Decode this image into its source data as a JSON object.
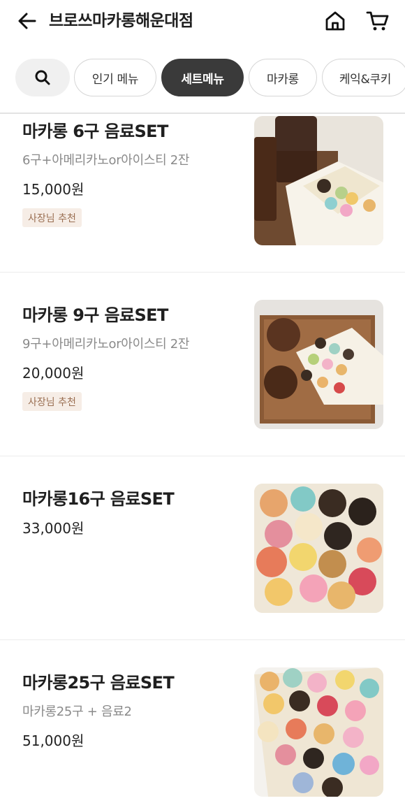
{
  "header": {
    "back_icon": "arrow-left-icon",
    "title": "브로쓰마카롱해운대점",
    "home_icon": "home-icon",
    "cart_icon": "cart-icon"
  },
  "tabs": {
    "search_icon": "search-icon",
    "items": [
      {
        "label": "인기 메뉴",
        "active": false
      },
      {
        "label": "세트메뉴",
        "active": true
      },
      {
        "label": "마카롱",
        "active": false
      },
      {
        "label": "케익&쿠키",
        "active": false
      }
    ]
  },
  "menu_items": [
    {
      "name": "마카롱 6구 음료SET",
      "desc": "6구+아메리카노or아이스티 2잔",
      "price": "15,000원",
      "badge": "사장님 추천"
    },
    {
      "name": "마카롱 9구 음료SET",
      "desc": "9구+아메리카노or아이스티 2잔",
      "price": "20,000원",
      "badge": "사장님 추천"
    },
    {
      "name": "마카롱16구 음료SET",
      "desc": "",
      "price": "33,000원",
      "badge": ""
    },
    {
      "name": "마카롱25구 음료SET",
      "desc": "마카롱25구 + 음료2",
      "price": "51,000원",
      "badge": ""
    }
  ],
  "colors": {
    "active_chip": "#3a3a3a",
    "badge_bg": "#f6ede6",
    "badge_text": "#9a6f52"
  }
}
